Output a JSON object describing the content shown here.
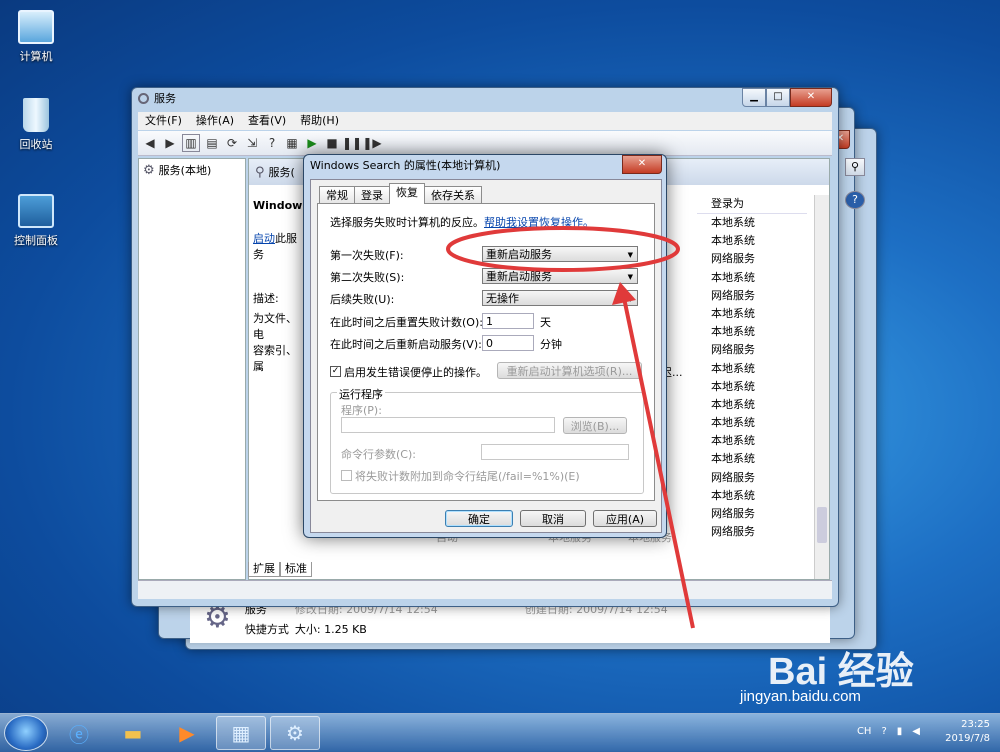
{
  "desktop": {
    "icons": [
      {
        "label": "计算机",
        "icon": "computer-icon"
      },
      {
        "label": "回收站",
        "icon": "recycle-bin-icon"
      },
      {
        "label": "控制面板",
        "icon": "control-panel-icon"
      }
    ]
  },
  "services_window": {
    "title": "服务",
    "menu": [
      "文件(F)",
      "操作(A)",
      "查看(V)",
      "帮助(H)"
    ],
    "tree_root": "服务(本地)",
    "detail_header": "服务(",
    "selected_service": "Windows",
    "start_link": "启动",
    "start_suffix": "此服务",
    "description_label": "描述:",
    "description_lines": [
      "为文件、电",
      "容索引、属"
    ],
    "logon_column_header": "登录为",
    "logon_values": [
      "本地系统",
      "本地系统",
      "网络服务",
      "本地系统",
      "网络服务",
      "本地系统",
      "本地系统",
      "网络服务",
      "本地系统",
      "本地系统",
      "本地系统",
      "本地系统",
      "本地系统",
      "本地系统",
      "网络服务",
      "本地系统",
      "网络服务",
      "网络服务"
    ],
    "partial_cell": "迟...",
    "bottom_tabs": [
      "扩展",
      "标准"
    ]
  },
  "back_window": {
    "name": "服务",
    "type": "快捷方式",
    "modified": "修改日期: 2009/7/14 12:54",
    "size": "大小: 1.25 KB",
    "created": "创建日期: 2009/7/14 12:54",
    "hidden_row_bits": [
      "自动",
      "本地服务",
      "本地服务"
    ]
  },
  "dialog": {
    "title": "Windows Search 的属性(本地计算机)",
    "tabs": [
      "常规",
      "登录",
      "恢复",
      "依存关系"
    ],
    "active_tab": 2,
    "intro": "选择服务失败时计算机的反应。",
    "help_link": "帮助我设置恢复操作。",
    "first_failure_label": "第一次失败(F):",
    "first_failure_value": "重新启动服务",
    "second_failure_label": "第二次失败(S):",
    "second_failure_value": "重新启动服务",
    "subsequent_label": "后续失败(U):",
    "subsequent_value": "无操作",
    "reset_label": "在此时间之后重置失败计数(O):",
    "reset_value": "1",
    "reset_unit": "天",
    "restart_label": "在此时间之后重新启动服务(V):",
    "restart_value": "0",
    "restart_unit": "分钟",
    "enable_actions_label": "启用发生错误便停止的操作。",
    "enable_actions_checked": "✓",
    "restart_options_button": "重新启动计算机选项(R)...",
    "run_program_group": "运行程序",
    "program_label": "程序(P):",
    "browse_button": "浏览(B)...",
    "cmd_params_label": "命令行参数(C):",
    "append_fail_label": "将失败计数附加到命令行结尾(/fail=%1%)(E)",
    "ok_button": "确定",
    "cancel_button": "取消",
    "apply_button": "应用(A)"
  },
  "taskbar": {
    "time": "23:25",
    "date": "2019/7/8",
    "lang": "CH"
  },
  "watermark": {
    "text": "Bai 经验",
    "url": "jingyan.baidu.com"
  }
}
